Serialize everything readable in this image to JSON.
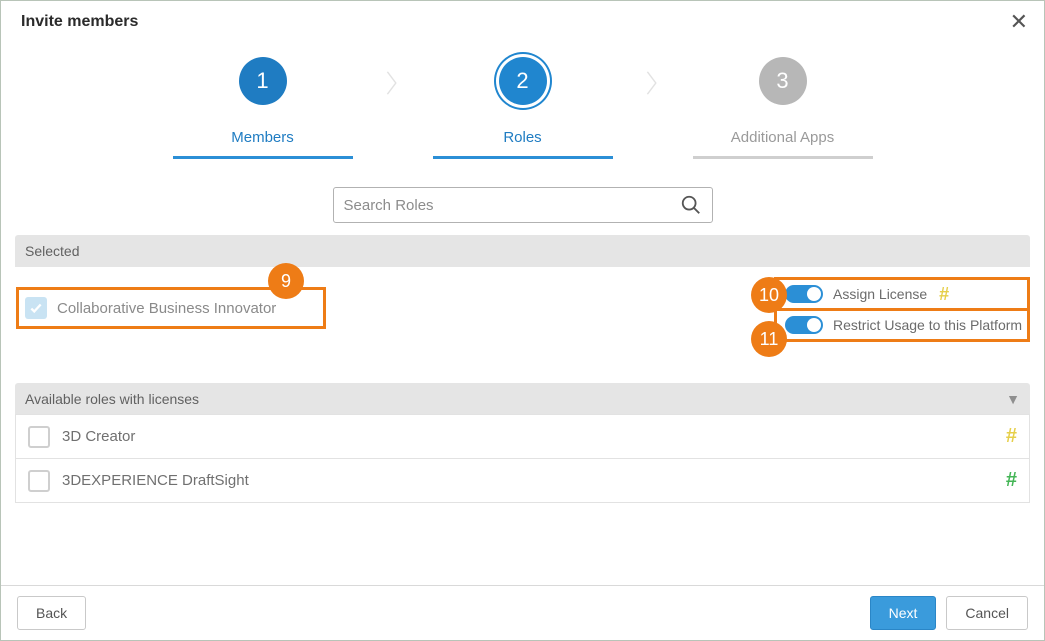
{
  "dialog": {
    "title": "Invite members"
  },
  "stepper": {
    "step1": {
      "num": "1",
      "label": "Members"
    },
    "step2": {
      "num": "2",
      "label": "Roles"
    },
    "step3": {
      "num": "3",
      "label": "Additional Apps"
    }
  },
  "search": {
    "placeholder": "Search Roles"
  },
  "sections": {
    "selected_header": "Selected",
    "available_header": "Available roles with licenses"
  },
  "selected": {
    "role_label": "Collaborative Business Innovator",
    "toggle_assign": "Assign License",
    "toggle_restrict": "Restrict Usage to this Platform"
  },
  "markers": {
    "m9": "9",
    "m10": "10",
    "m11": "11"
  },
  "available": {
    "row1": "3D Creator",
    "row2": "3DEXPERIENCE DraftSight"
  },
  "footer": {
    "back": "Back",
    "next": "Next",
    "cancel": "Cancel"
  }
}
